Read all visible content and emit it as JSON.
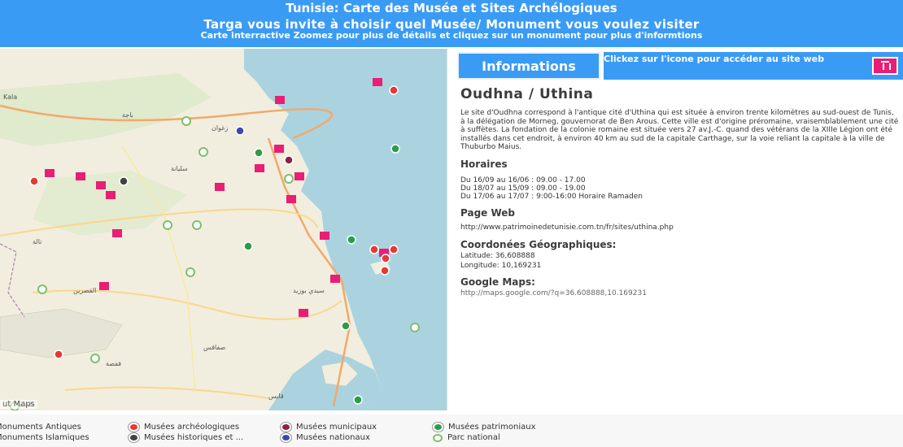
{
  "header": {
    "title": "Tunisie: Carte des Musée et Sites Archélogiques",
    "subtitle": "Targa vous invite à choisir quel Musée/ Monument vous voulez visiter",
    "instructions": "Carte interractive Zoomez pour plus de détails et cliquez sur un monument pour plus d'informtions"
  },
  "map": {
    "attribution": "ut Maps"
  },
  "info": {
    "button_label": "Informations",
    "web_link_label": "Clickez sur l'icone pour accéder au site web",
    "site_name": "Oudhna / Uthina",
    "description": "Le site d'Oudhna correspond à l'antique cité d'Uthina qui est située à environ trente kilomètres au sud-ouest de Tunis, à la délégation de Morneg, gouvernorat de Ben Arous. Cette ville est d'origine préromaine, vraisemblablement une cité à suffètes. La fondation de la colonie romaine est située vers 27 av.J.-C. quand des vétérans de la XIIIe Légion ont été installés dans cet endroit, à environ 40 km au sud de la capitale Carthage, sur la voie reliant la capitale à la ville de Thuburbo Maius.",
    "hours_title": "Horaires",
    "hours": [
      "Du 16/09 au 16/06 : 09.00 - 17.00",
      "Du 18/07 au 15/09 : 09.00 - 19.00",
      "Du 17/06 au 17/07 : 9:00-16:00 Horaire Ramaden"
    ],
    "web_title": "Page Web",
    "web_url": "http://www.patrimoinedetunisie.com.tn/fr/sites/uthina.php",
    "coords_title": "Coordonées Géographiques:",
    "latitude": "Latitude: 36,608888",
    "longitude": "Longitude: 10,169231",
    "gmaps_title": "Google Maps:",
    "gmaps_url": "http://maps.google.com/?q=36.608888,10.169231"
  },
  "legend": {
    "items": [
      {
        "label": "Monuments Antiques",
        "icon": "monument-antique-icon"
      },
      {
        "label": "Monuments Islamiques",
        "icon": "monument-islamic-icon"
      },
      {
        "label": "Musées archéologiques",
        "color": "#e53935"
      },
      {
        "label": "Musées historiques et ...",
        "color": "#424242"
      },
      {
        "label": "Musées municipaux",
        "color": "#8e2146"
      },
      {
        "label": "Musées nationaux",
        "color": "#3949ab"
      },
      {
        "label": "Musées patrimoniaux",
        "color": "#2e9b4b"
      },
      {
        "label": "Parc national",
        "color": "#7cc06d"
      }
    ]
  }
}
